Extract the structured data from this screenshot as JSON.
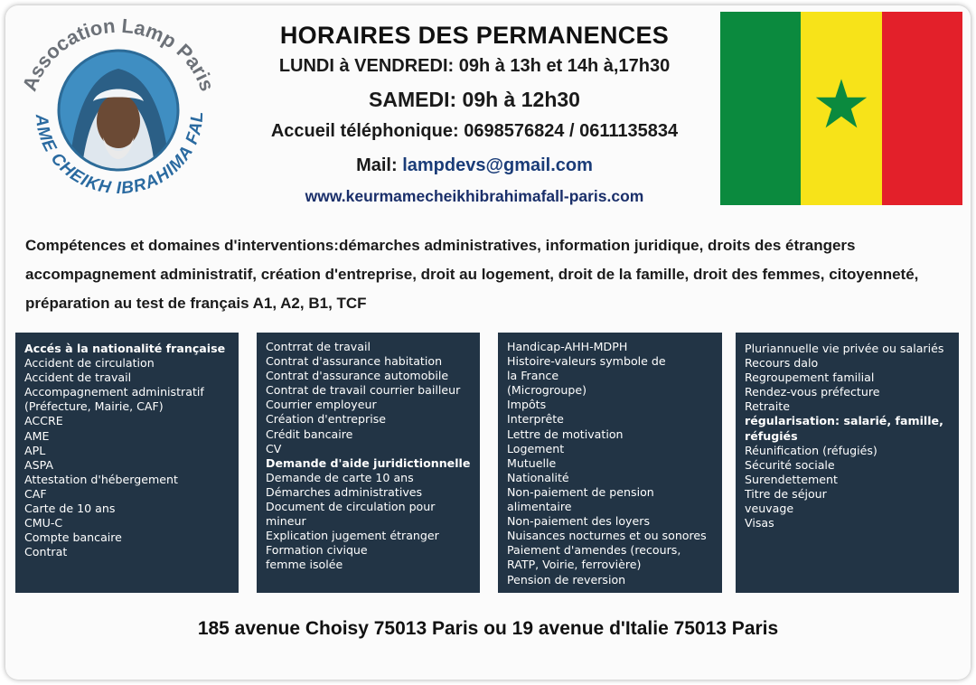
{
  "logo": {
    "arc_top": "Assocation Lamp Paris",
    "arc_bottom": "MAME CHEIKH IBRAHIMA FALL"
  },
  "header": {
    "title": "HORAIRES DES PERMANENCES",
    "hours_weekday": "LUNDI à VENDREDI: 09h à 13h et 14h à,17h30",
    "hours_saturday": "SAMEDI:  09h à 12h30",
    "phone": "Accueil téléphonique: 0698576824 / 0611135834",
    "mail_label": "Mail: ",
    "mail_value": "lampdevs@gmail.com",
    "website": "www.keurmamecheikhibrahimafall-paris.com"
  },
  "flag": {
    "colors": [
      "#0b8a3e",
      "#f7e319",
      "#e3202a"
    ],
    "star_color": "#0b8a3e"
  },
  "skills": {
    "text": "Compétences et domaines d'interventions:démarches administratives, information juridique, droits des étrangers accompagnement administratif, création d'entreprise, droit au logement, droit de la famille, droit des femmes, citoyenneté, préparation au test de français A1, A2, B1, TCF"
  },
  "columns": [
    {
      "items": [
        {
          "text": "Accés à la nationalité française",
          "bold": true
        },
        {
          "text": "Accident de circulation"
        },
        {
          "text": "Accident de travail"
        },
        {
          "text": "Accompagnement administratif"
        },
        {
          "text": "(Préfecture, Mairie, CAF)"
        },
        {
          "text": "ACCRE"
        },
        {
          "text": "AME"
        },
        {
          "text": "APL"
        },
        {
          "text": "ASPA"
        },
        {
          "text": "Attestation d'hébergement"
        },
        {
          "text": "CAF"
        },
        {
          "text": "Carte de 10 ans"
        },
        {
          "text": "CMU-C"
        },
        {
          "text": "Compte bancaire"
        },
        {
          "text": "Contrat"
        }
      ]
    },
    {
      "items": [
        {
          "text": "Contrrat de travail"
        },
        {
          "text": "Contrat d'assurance habitation"
        },
        {
          "text": "Contrat d'assurance automobile"
        },
        {
          "text": "Contrat de travail courrier bailleur"
        },
        {
          "text": "Courrier employeur"
        },
        {
          "text": "Création d'entreprise"
        },
        {
          "text": "Crédit bancaire"
        },
        {
          "text": "CV"
        },
        {
          "text": "Demande d'aide juridictionnelle",
          "bold": true
        },
        {
          "text": "Demande de carte 10 ans"
        },
        {
          "text": "Démarches administratives"
        },
        {
          "text": "Document de circulation pour"
        },
        {
          "text": "mineur"
        },
        {
          "text": "Explication jugement étranger"
        },
        {
          "text": "Formation civique"
        },
        {
          "text": "femme isolée"
        }
      ]
    },
    {
      "items": [
        {
          "text": "Handicap-AHH-MDPH"
        },
        {
          "text": "Histoire-valeurs symbole de"
        },
        {
          "text": " la France"
        },
        {
          "text": "(Microgroupe)"
        },
        {
          "text": "Impôts"
        },
        {
          "text": "Interprête"
        },
        {
          "text": "Lettre de motivation"
        },
        {
          "text": "Logement"
        },
        {
          "text": "Mutuelle"
        },
        {
          "text": "Nationalité"
        },
        {
          "text": "Non-paiement de pension"
        },
        {
          "text": "alimentaire"
        },
        {
          "text": "Non-paiement des loyers"
        },
        {
          "text": "Nuisances nocturnes et ou sonores"
        },
        {
          "text": "Paiement d'amendes (recours,"
        },
        {
          "text": "RATP, Voirie, ferrovière)"
        },
        {
          "text": "Pension de reversion"
        }
      ]
    },
    {
      "items": [
        {
          "text": "Pluriannuelle vie privée ou salariés"
        },
        {
          "text": "Recours dalo"
        },
        {
          "text": "Regroupement familial"
        },
        {
          "text": "Rendez-vous préfecture"
        },
        {
          "text": "Retraite"
        },
        {
          "text": "régularisation: salarié, famille,",
          "bold": true
        },
        {
          "text": "réfugiés",
          "bold": true
        },
        {
          "text": "Réunification (réfugiés)"
        },
        {
          "text": "Sécurité sociale"
        },
        {
          "text": "Surendettement"
        },
        {
          "text": "Titre de séjour"
        },
        {
          "text": "veuvage"
        },
        {
          "text": "Visas"
        }
      ]
    }
  ],
  "footer": {
    "address": "185 avenue Choisy 75013 Paris ou 19 avenue d'Italie 75013 Paris"
  }
}
